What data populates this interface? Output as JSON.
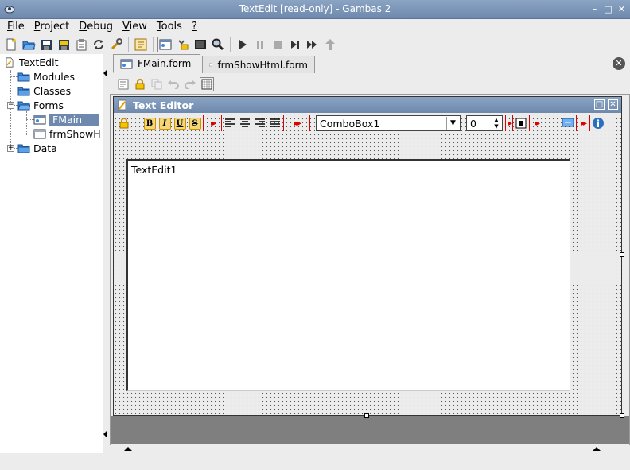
{
  "window": {
    "title": "TextEdit [read-only] - Gambas 2"
  },
  "menu": [
    {
      "label": "File",
      "u": "F",
      "rest": "ile"
    },
    {
      "label": "Project",
      "u": "P",
      "rest": "roject"
    },
    {
      "label": "Debug",
      "u": "D",
      "rest": "ebug"
    },
    {
      "label": "View",
      "u": "V",
      "rest": "iew"
    },
    {
      "label": "Tools",
      "u": "T",
      "rest": "ools"
    },
    {
      "label": "?",
      "u": "?",
      "rest": ""
    }
  ],
  "tree": {
    "root": "TextEdit",
    "modules": "Modules",
    "classes": "Classes",
    "forms": "Forms",
    "form_fmain": "FMain",
    "form_show": "frmShowH",
    "data": "Data"
  },
  "tabs": [
    {
      "label": "FMain.form",
      "active": true
    },
    {
      "label": "frmShowHtml.form",
      "active": false
    }
  ],
  "form": {
    "title": "Text Editor",
    "fmt_bold": "B",
    "fmt_italic": "I",
    "fmt_underline": "U",
    "fmt_strike": "S",
    "combo_value": "ComboBox1",
    "spin_value": "0",
    "textedit_text": "TextEdit1"
  },
  "colors": {
    "titlebar": "#6e89ad",
    "selection": "#6e89ad",
    "marker_red": "#dd0000",
    "designer_bottom": "#7f7f7f"
  }
}
